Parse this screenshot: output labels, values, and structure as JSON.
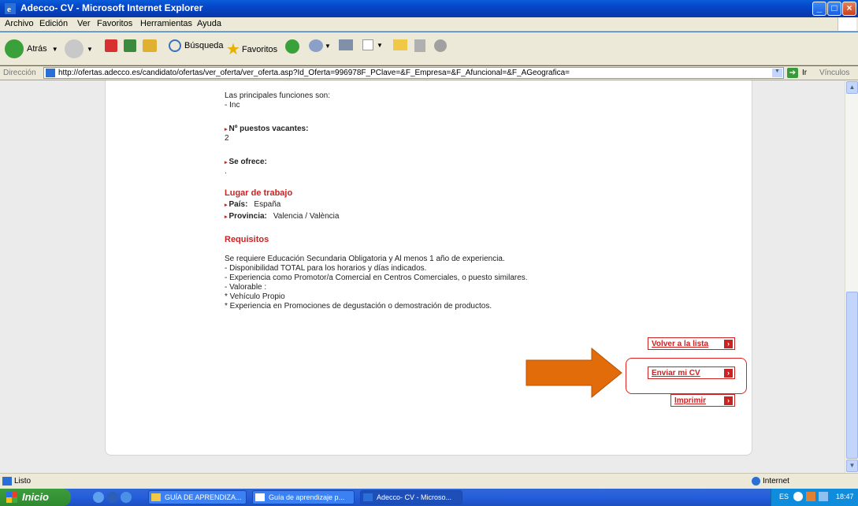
{
  "window": {
    "title": "Adecco- CV - Microsoft Internet Explorer"
  },
  "menu": [
    "Archivo",
    "Edición",
    "Ver",
    "Favoritos",
    "Herramientas",
    "Ayuda"
  ],
  "toolbar": {
    "back": "Atrás",
    "search": "Búsqueda",
    "favorites": "Favoritos"
  },
  "address": {
    "label": "Dirección",
    "url": "http://ofertas.adecco.es/candidato/ofertas/ver_oferta/ver_oferta.asp?Id_Oferta=996978F_PClave=&F_Empresa=&F_Afuncional=&F_AGeografica=",
    "go": "Ir",
    "links": "Vínculos"
  },
  "content": {
    "funciones_intro": "Las principales funciones son:",
    "funciones_item": "- Inc",
    "vacantes_label": "Nº puestos vacantes:",
    "vacantes_value": "2",
    "ofrece_label": "Se ofrece:",
    "ofrece_value": ".",
    "lugar_title": "Lugar de trabajo",
    "pais_label": "País:",
    "pais_value": "España",
    "provincia_label": "Provincia:",
    "provincia_value": "Valencia / València",
    "requisitos_title": "Requisitos",
    "requisitos_lines": [
      "Se requiere Educación Secundaria Obligatoria y Al menos 1 año de experiencia.",
      "- Disponibilidad TOTAL para los horarios y días indicados.",
      "- Experiencia como Promotor/a Comercial en Centros Comerciales, o puesto similares.",
      "- Valorable :",
      "* Vehículo Propio",
      "* Experiencia en Promociones de degustación o demostración de productos."
    ]
  },
  "buttons": {
    "volver": "Volver a la lista",
    "enviar": "Enviar mi CV",
    "imprimir": "Imprimir"
  },
  "status": {
    "text": "Listo",
    "zone": "Internet"
  },
  "taskbar": {
    "start": "Inicio",
    "tasks": [
      "GUÍA DE APRENDIZA...",
      "Guía de aprendizaje p...",
      "Adecco- CV - Microso..."
    ],
    "lang": "ES",
    "clock": "18:47"
  },
  "colors": {
    "accent": "#cc2222",
    "arrow": "#e36c0a"
  }
}
